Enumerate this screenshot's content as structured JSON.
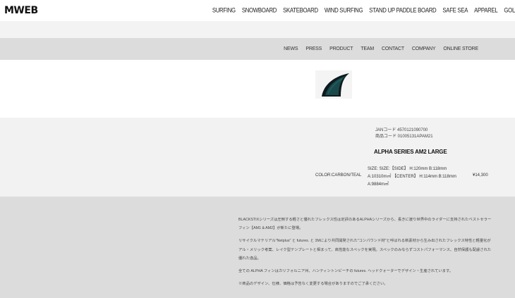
{
  "header": {
    "logo": "MWEB",
    "nav": [
      "SURFING",
      "SNOWBOARD",
      "SKATEBOARD",
      "WIND SURFING",
      "STAND UP PADDLE BOARD",
      "SAFE SEA",
      "APPAREL",
      "GOL"
    ]
  },
  "subnav": [
    "NEWS",
    "PRESS",
    "PRODUCT",
    "TEAM",
    "CONTACT",
    "COMPANY",
    "ONLINE STORE"
  ],
  "product": {
    "jan": "JANコード 4570121090700",
    "code": "商品コード 01005131APAM21",
    "name": "ALPHA SERIES AM2 LARGE",
    "color": "COLOR:CARBON/TEAL",
    "size_line1": "SIZE: SIZE:【SIDE】 H:120mm B:118mm",
    "size_line2": "A:10310m㎡ 【CENTER】 H:114mm B:118mm",
    "size_line3": "A:9884m㎡",
    "price": "¥14,300",
    "image_icon": "fin-image"
  },
  "description": {
    "p1": "BLACKSTIXシリーズは圧倒する軽さと優れたフレックス性は定評のあるALPHAシリーズから、長きに渡り世界中のライダーに支持されたベストセラーフィン【AM1 & AM2】が新たに登場。",
    "p2": "リサイクルマテリアル\"Netplus\" と futures. と 3Mにより共同開発された\"コンパウンド材\"と呼ばれる新素材から生み出されたフレックス特性と軽量化がアル・メリック考案、レイク型テンプレートと相まって、高性能なスペックを実現。スペックのみならずコストパフォーマンス、自然保護も配慮された優れた逸品。",
    "p3": "全ての ALPHA フィンはカリフォルニア州、ハンティントンビーチの futures. ヘッドクォーターでデザイン・生産されています。",
    "p4": "※商品のデザイン、仕様、価格は予告なく変更する場合がありますのでご了承ください。"
  },
  "colors": {
    "band_light": "#f3f3f3",
    "subnav_bg": "#dcdcdc",
    "fin_teal": "#1f5a5c",
    "fin_dark": "#0e1a1d"
  }
}
